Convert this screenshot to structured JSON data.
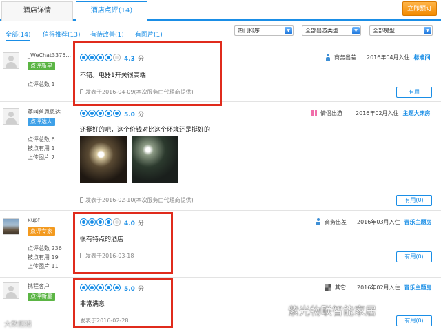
{
  "tabs": {
    "hotel_details": "酒店详情",
    "hotel_reviews": "酒店点评(14)",
    "book_now": "立即预订"
  },
  "filters": {
    "links": [
      "全部(14)",
      "值得推荐(13)",
      "有待改善(1)",
      "有图片(1)"
    ],
    "sort": "热门排序",
    "trip_type": "全部出游类型",
    "room_type": "全部房型"
  },
  "reviews": [
    {
      "user": "_WeChat3375...",
      "badge": "点评新星",
      "stats": [
        "点评总数 1"
      ],
      "stars_filled": 4,
      "score": "4.3",
      "score_unit": "分",
      "comment": "不错。电器1开关很高端",
      "posted": "发表于2016-04-09(本次服务由代理商提供)",
      "trip_type": "商务出差",
      "stay": "2016年04月入住",
      "room": "标准间",
      "helpful": "有用"
    },
    {
      "user": "蒋叫兽恩恩达",
      "badge": "点评达人",
      "stats": [
        "点评总数 6",
        "被点有用 1",
        "上传图片 7"
      ],
      "stars_filled": 5,
      "score": "5.0",
      "score_unit": "分",
      "comment": "还挺好的吧，这个价钱对比这个环境还是挺好的",
      "posted": "发表于2016-02-10(本次服务由代理商提供)",
      "trip_type": "情侣出游",
      "stay": "2016年02月入住",
      "room": "主题大床房",
      "helpful": "有用(0)"
    },
    {
      "user": "xupf",
      "badge": "点评专家",
      "stats": [
        "点评总数 236",
        "被点有用 19",
        "上传图片 11"
      ],
      "stars_filled": 4,
      "score": "4.0",
      "score_unit": "分",
      "comment": "很有特点的酒店",
      "posted": "发表于2016-03-18",
      "trip_type": "商务出差",
      "stay": "2016年03月入住",
      "room": "音乐主题房",
      "helpful": "有用(0)"
    },
    {
      "user": "携程客户",
      "badge": "点评新星",
      "stats": [],
      "stars_filled": 5,
      "score": "5.0",
      "score_unit": "分",
      "comment": "非常满意",
      "posted": "发表于2016-02-28",
      "trip_type": "其它",
      "stay": "2016年02月入住",
      "room": "音乐主题房",
      "helpful": "有用(0)"
    }
  ],
  "watermarks": {
    "left": "大数据猎",
    "right": "紫光物联智能家居"
  },
  "colors": {
    "accent": "#1a8ee6",
    "highlight_box": "#e02b1c",
    "book_button": "#f28a00"
  }
}
